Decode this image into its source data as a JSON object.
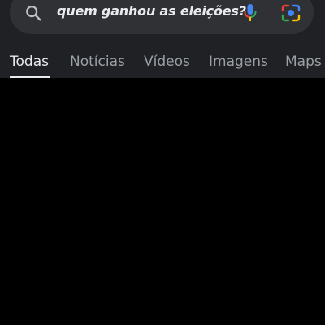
{
  "search": {
    "query": "quem ganhou as eleições?",
    "search_icon": "search-icon",
    "mic_icon": "microphone-icon",
    "lens_icon": "google-lens-icon"
  },
  "tabs": [
    {
      "label": "Todas",
      "active": true
    },
    {
      "label": "Notícias",
      "active": false
    },
    {
      "label": "Vídeos",
      "active": false
    },
    {
      "label": "Imagens",
      "active": false
    },
    {
      "label": "Maps",
      "active": false
    }
  ],
  "colors": {
    "header_bg": "#202124",
    "search_bg": "#303134",
    "page_bg": "#000000",
    "active_tab": "#e8eaed",
    "inactive_tab": "#9aa0a6",
    "mic_blue": "#4285f4",
    "mic_red": "#ea4335",
    "mic_yellow": "#fbbc04",
    "mic_green": "#34a853"
  }
}
